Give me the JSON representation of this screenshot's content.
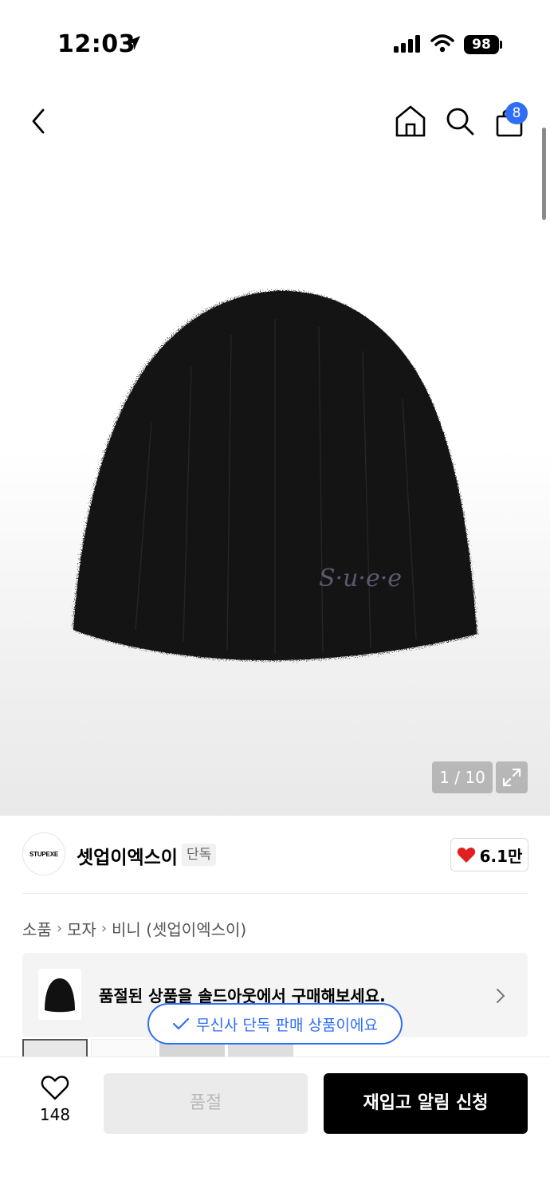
{
  "status_bar": {
    "time": "12:03",
    "battery": "98",
    "icons": [
      "location-arrow-icon",
      "signal-icon",
      "wifi-icon",
      "battery-icon"
    ]
  },
  "nav": {
    "cart_badge": "8",
    "icons": [
      "chevron-left-icon",
      "home-icon",
      "search-icon",
      "shopping-bag-icon"
    ]
  },
  "product_image": {
    "logo_text": "S·u·e·e"
  },
  "gallery": {
    "counter": "1 / 10",
    "expand_icon": "expand-icon"
  },
  "brand": {
    "logo_text": "STUPEXE",
    "name": "셋업이엑스이",
    "tag": "단독",
    "like_count": "6.1만",
    "like_color": "#e02020"
  },
  "breadcrumb": {
    "items": [
      "소품",
      "모자",
      "비니 (셋업이엑스이)"
    ]
  },
  "soldout_banner": {
    "text": "품절된 상품을 솔드아웃에서 구매해보세요."
  },
  "toast": {
    "text": "무신사 단독 판매 상품이에요",
    "color": "#2f6df6"
  },
  "bottom_bar": {
    "wish_count": "148",
    "soldout_label": "품절",
    "restock_label": "재입고 알림 신청"
  }
}
